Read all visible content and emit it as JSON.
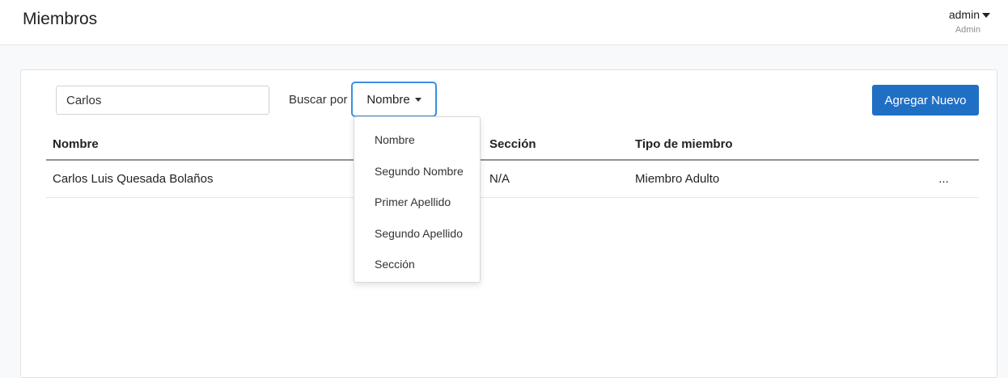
{
  "header": {
    "title": "Miembros",
    "user_name": "admin",
    "user_role": "Admin"
  },
  "search": {
    "value": "Carlos",
    "by_label": "Buscar por",
    "by_selected": "Nombre",
    "options": [
      "Nombre",
      "Segundo Nombre",
      "Primer Apellido",
      "Segundo Apellido",
      "Sección"
    ]
  },
  "add_button": "Agregar Nuevo",
  "table": {
    "columns": [
      "Nombre",
      "",
      "Sección",
      "Tipo de miembro",
      ""
    ],
    "rows": [
      {
        "nombre": "Carlos Luis Quesada Bolaños",
        "col2": "",
        "seccion": "N/A",
        "tipo": "Miembro Adulto",
        "actions": "..."
      }
    ]
  },
  "colors": {
    "accent": "#1f6fc5",
    "focus_border": "#3b8fe0"
  }
}
